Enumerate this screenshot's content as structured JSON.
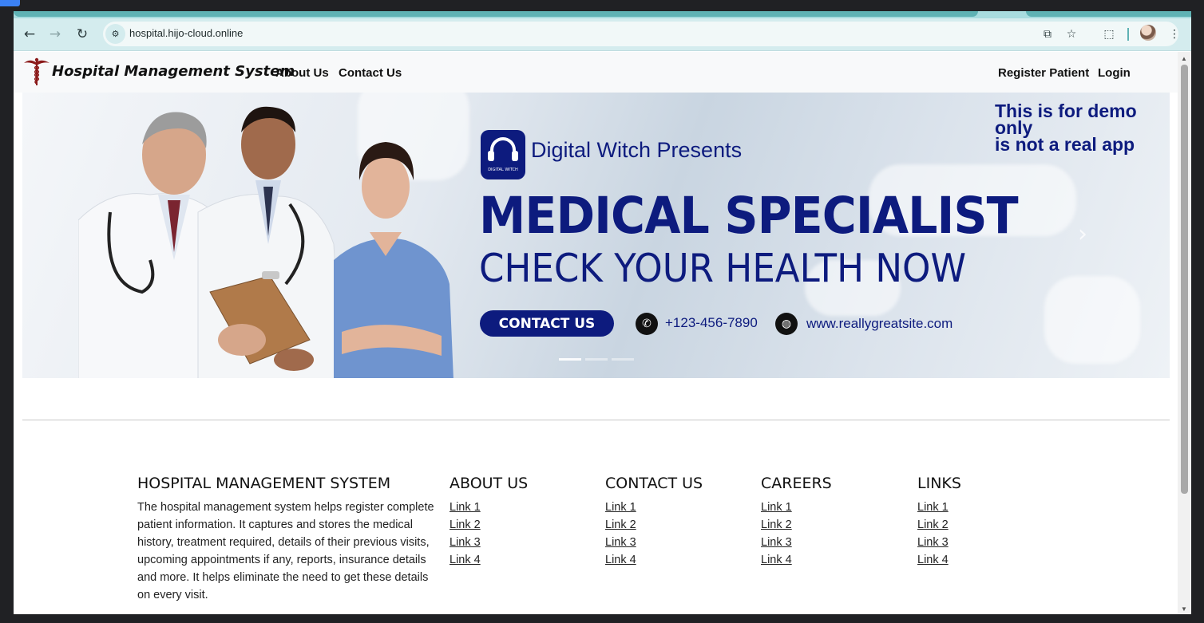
{
  "browser": {
    "url": "hospital.hijo-cloud.online"
  },
  "nav": {
    "brand": "Hospital Management System",
    "links": [
      "About Us",
      "Contact Us"
    ],
    "right_links": [
      "Register Patient",
      "Login"
    ]
  },
  "banner": {
    "presents": "Digital Witch  Presents",
    "logo_text": "DIGITAL WITCH",
    "demo_line1": "This is for demo",
    "demo_line2": "only",
    "demo_line3": "is not a real app",
    "headline": "MEDICAL SPECIALIST",
    "subheadline": "CHECK YOUR HEALTH NOW",
    "cta": "CONTACT US",
    "phone": "+123-456-7890",
    "website": "www.reallygreatsite.com"
  },
  "footer": {
    "about": {
      "title": "HOSPITAL MANAGEMENT SYSTEM",
      "description": "The hospital management system helps register complete patient information. It captures and stores the medical history, treatment required, details of their previous visits, upcoming appointments if any, reports, insurance details and more. It helps eliminate the need to get these details on every visit."
    },
    "columns": [
      {
        "title": "ABOUT US",
        "links": [
          "Link 1",
          "Link 2",
          "Link 3",
          "Link 4"
        ]
      },
      {
        "title": "CONTACT US",
        "links": [
          "Link 1",
          "Link 2",
          "Link 3",
          "Link 4"
        ]
      },
      {
        "title": "CAREERS",
        "links": [
          "Link 1",
          "Link 2",
          "Link 3",
          "Link 4"
        ]
      },
      {
        "title": "LINKS",
        "links": [
          "Link 1",
          "Link 2",
          "Link 3",
          "Link 4"
        ]
      }
    ]
  },
  "colors": {
    "banner_navy": "#0d1b7e",
    "toolbar": "#d4ecee",
    "tab_accent": "#5fb2b4",
    "logo_red": "#8b1a1a"
  },
  "icons": [
    "back-icon",
    "forward-icon",
    "reload-icon",
    "site-info-icon",
    "install-app-icon",
    "bookmark-star-icon",
    "extensions-icon",
    "profile-avatar",
    "menu-kebab-icon",
    "caduceus-logo",
    "phone-icon",
    "globe-icon",
    "chevron-right-icon"
  ]
}
